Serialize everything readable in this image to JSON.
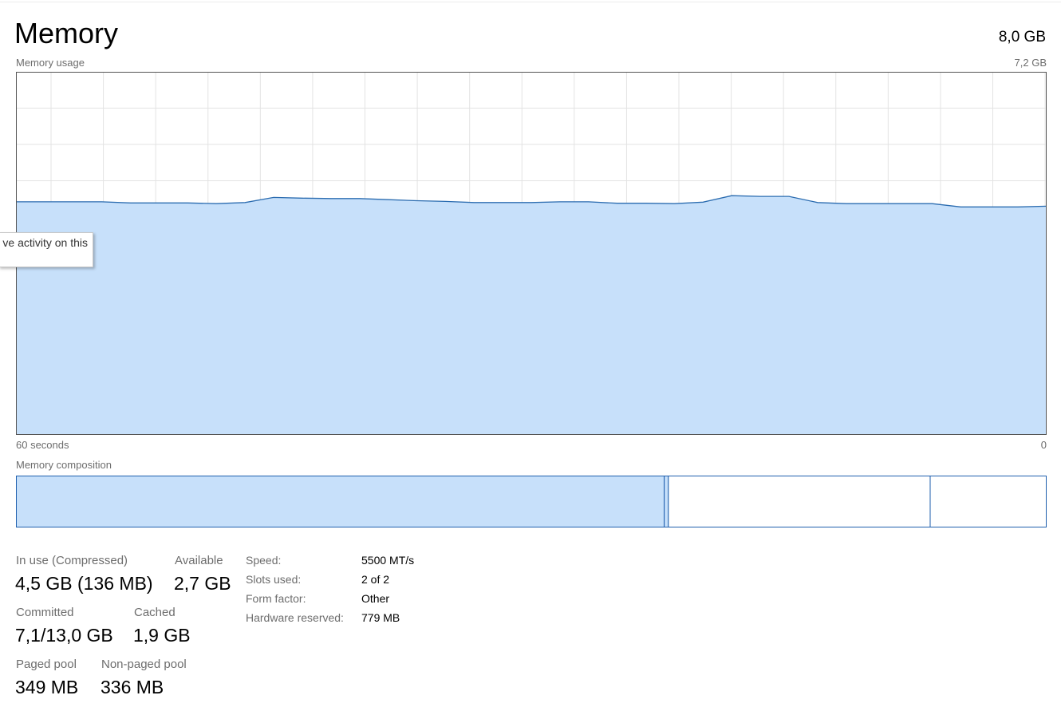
{
  "header": {
    "title": "Memory",
    "total": "8,0 GB"
  },
  "graph": {
    "label": "Memory usage",
    "max_label": "7,2 GB",
    "left_time_label": "60 seconds",
    "right_time_label": "0"
  },
  "composition": {
    "label": "Memory composition"
  },
  "tooltip": {
    "text": "Change graph to show activity on this",
    "visible_text": "ve activity on this"
  },
  "stats": {
    "in_use": {
      "label": "In use (Compressed)",
      "value": "4,5 GB (136 MB)"
    },
    "available": {
      "label": "Available",
      "value": "2,7 GB"
    },
    "committed": {
      "label": "Committed",
      "value": "7,1/13,0 GB"
    },
    "cached": {
      "label": "Cached",
      "value": "1,9 GB"
    },
    "paged_pool": {
      "label": "Paged pool",
      "value": "349 MB"
    },
    "non_paged_pool": {
      "label": "Non-paged pool",
      "value": "336 MB"
    }
  },
  "specs": {
    "speed": {
      "label": "Speed:",
      "value": "5500 MT/s"
    },
    "slots": {
      "label": "Slots used:",
      "value": "2 of 2"
    },
    "form_factor": {
      "label": "Form factor:",
      "value": "Other"
    },
    "hardware_reserved": {
      "label": "Hardware reserved:",
      "value": "779 MB"
    }
  },
  "chart_data": {
    "type": "area",
    "x_range": [
      60,
      0
    ],
    "y_range": [
      0,
      7.2
    ],
    "grid": true,
    "colors": {
      "fill": "#c7e0fa",
      "line": "#2b6cb0",
      "border": "#1f5fae",
      "grid": "#e3e3e3"
    },
    "usage_fraction": [
      0.642,
      0.642,
      0.642,
      0.642,
      0.639,
      0.639,
      0.639,
      0.637,
      0.64,
      0.654,
      0.652,
      0.651,
      0.651,
      0.648,
      0.645,
      0.643,
      0.64,
      0.64,
      0.64,
      0.642,
      0.642,
      0.638,
      0.638,
      0.637,
      0.641,
      0.659,
      0.657,
      0.657,
      0.64,
      0.637,
      0.637,
      0.637,
      0.637,
      0.628,
      0.628,
      0.628,
      0.63
    ],
    "composition": {
      "in_use_fraction": 0.629,
      "modified_fraction": 0.004,
      "standby_fraction": 0.254,
      "free_fraction": 0.113
    }
  }
}
